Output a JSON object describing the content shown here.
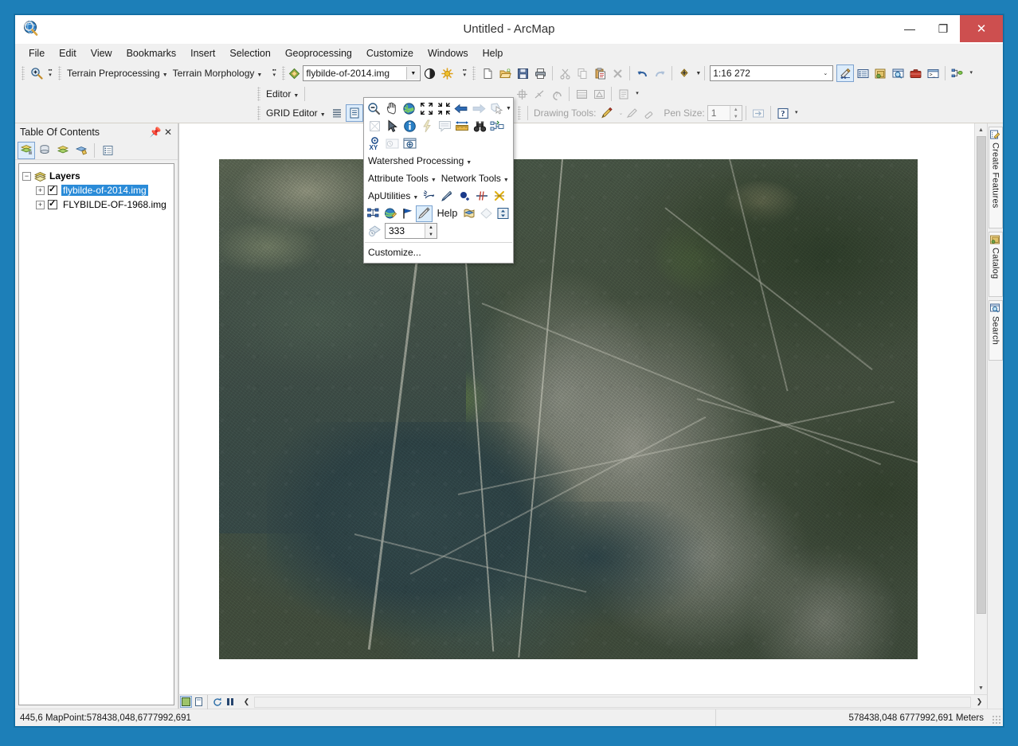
{
  "window": {
    "title": "Untitled - ArcMap",
    "app_icon": "arcmap-globe-icon",
    "minimize_label": "—",
    "maximize_label": "❐",
    "close_label": "✕"
  },
  "menubar": {
    "items": [
      {
        "label": "File"
      },
      {
        "label": "Edit"
      },
      {
        "label": "View"
      },
      {
        "label": "Bookmarks"
      },
      {
        "label": "Insert"
      },
      {
        "label": "Selection"
      },
      {
        "label": "Geoprocessing"
      },
      {
        "label": "Customize"
      },
      {
        "label": "Windows"
      },
      {
        "label": "Help"
      }
    ]
  },
  "toolbars": {
    "terrain": {
      "preprocessing_label": "Terrain Preprocessing",
      "morphology_label": "Terrain Morphology"
    },
    "image_analysis": {
      "layer_value": "flybilde-of-2014.img",
      "contrast_icon": "contrast-icon",
      "brightness_icon": "brightness-icon"
    },
    "standard": {
      "new_icon": "new-document-icon",
      "open_icon": "open-folder-icon",
      "save_icon": "save-icon",
      "print_icon": "print-icon",
      "cut_icon": "cut-icon",
      "copy_icon": "copy-icon",
      "paste_icon": "paste-icon",
      "delete_icon": "delete-x-icon",
      "undo_icon": "undo-icon",
      "redo_icon": "redo-icon",
      "add_data_icon": "add-data-icon",
      "scale_value": "1:16 272",
      "editor_toolbar_icon": "editor-toolbar-icon",
      "toc_icon": "table-of-contents-icon",
      "catalog_icon": "catalog-window-icon",
      "search_icon": "search-window-icon",
      "arctoolbox_icon": "arctoolbox-icon",
      "python_icon": "python-window-icon",
      "modelbuilder_icon": "model-builder-icon"
    },
    "editor": {
      "label": "Editor"
    },
    "grid_editor": {
      "label": "GRID Editor",
      "list_icon": "grid-list-icon",
      "attributes_icon": "grid-attributes-icon"
    },
    "topology": {
      "move_icon": "move-node-icon",
      "line_icon": "sketch-line-icon",
      "undo_icon": "topology-undo-icon",
      "table_icon": "table-icon",
      "errors_icon": "error-inspector-icon",
      "props_icon": "properties-icon"
    },
    "drawing": {
      "label": "Drawing Tools:",
      "pencil_icon": "pencil-icon",
      "highlighter_icon": "highlighter-icon",
      "eraser_icon": "eraser-icon",
      "pen_size_label": "Pen Size:",
      "pen_size_value": "1",
      "apply_icon": "apply-arrow-icon",
      "help_icon": "help-question-icon"
    }
  },
  "overflow_panel": {
    "row1": [
      {
        "icon": "zoom-out-icon",
        "name": "zoom-out"
      },
      {
        "icon": "pan-hand-icon",
        "name": "pan"
      },
      {
        "icon": "full-extent-globe-icon",
        "name": "full-extent"
      },
      {
        "icon": "fixed-zoom-in-icon",
        "name": "fixed-zoom-in"
      },
      {
        "icon": "fixed-zoom-out-icon",
        "name": "fixed-zoom-out"
      },
      {
        "icon": "back-extent-arrow-icon",
        "name": "previous-extent"
      },
      {
        "icon": "forward-extent-arrow-icon",
        "name": "next-extent"
      },
      {
        "icon": "select-features-icon",
        "name": "select-features"
      }
    ],
    "row2": [
      {
        "icon": "select-graphics-icon",
        "name": "select-elements"
      },
      {
        "icon": "pointer-arrow-icon",
        "name": "select-elements-pointer"
      },
      {
        "icon": "identify-info-icon",
        "name": "identify"
      },
      {
        "icon": "hyperlink-lightning-icon",
        "name": "hyperlink"
      },
      {
        "icon": "html-popup-icon",
        "name": "html-popup"
      },
      {
        "icon": "measure-ruler-icon",
        "name": "measure"
      },
      {
        "icon": "find-binoculars-icon",
        "name": "find"
      },
      {
        "icon": "find-route-icon",
        "name": "find-route"
      }
    ],
    "row3": [
      {
        "icon": "go-to-xy-icon",
        "name": "go-to-xy"
      },
      {
        "icon": "time-slider-icon",
        "name": "time-slider"
      },
      {
        "icon": "create-viewer-window-icon",
        "name": "create-viewer-window"
      }
    ],
    "watershed_label": "Watershed Processing",
    "attribute_tools_label": "Attribute Tools",
    "network_tools_label": "Network Tools",
    "aputilities_label": "ApUtilities",
    "aputil_icons": [
      {
        "icon": "trace-network-icon",
        "name": "trace-network"
      },
      {
        "icon": "edit-line-icon",
        "name": "edit-line"
      },
      {
        "icon": "add-point-icon",
        "name": "add-point"
      },
      {
        "icon": "split-line-icon",
        "name": "split-line"
      },
      {
        "icon": "delete-feature-icon",
        "name": "delete-feature"
      }
    ],
    "row5": [
      {
        "icon": "schematic-network-icon",
        "name": "schematic-network"
      },
      {
        "icon": "globe-edit-icon",
        "name": "globe-edit"
      },
      {
        "icon": "flag-icon",
        "name": "set-flag"
      },
      {
        "icon": "pencil-edit-icon",
        "name": "pencil-edit",
        "active": true
      }
    ],
    "help_label": "Help",
    "row5b": [
      {
        "icon": "layer-package-icon",
        "name": "layer-package"
      },
      {
        "icon": "diamond-icon",
        "name": "diamond-tool"
      },
      {
        "icon": "elevation-profile-icon",
        "name": "elevation-profile"
      }
    ],
    "spin_icon": "history-clock-icon",
    "spin_value": "333",
    "customize_label": "Customize..."
  },
  "toc": {
    "title": "Table Of Contents",
    "pin_icon": "pin-icon",
    "close_icon": "close-icon",
    "toolbar": [
      {
        "icon": "list-by-drawing-order-icon",
        "name": "list-by-drawing-order",
        "active": true
      },
      {
        "icon": "list-by-source-icon",
        "name": "list-by-source"
      },
      {
        "icon": "list-by-visibility-icon",
        "name": "list-by-visibility"
      },
      {
        "icon": "list-by-selection-icon",
        "name": "list-by-selection"
      },
      {
        "icon": "options-icon",
        "name": "toc-options"
      }
    ],
    "root": {
      "label": "Layers",
      "expander": "−",
      "icon": "layers-stack-icon"
    },
    "layers": [
      {
        "label": "flybilde-of-2014.img",
        "checked": true,
        "selected": true,
        "expander": "+"
      },
      {
        "label": "FLYBILDE-OF-1968.img",
        "checked": true,
        "selected": false,
        "expander": "+"
      }
    ]
  },
  "map_bottom": {
    "data_view_icon": "data-view-icon",
    "layout_view_icon": "layout-view-icon",
    "refresh_icon": "refresh-icon",
    "pause_icon": "pause-drawing-icon",
    "collapse_icon": "collapse-arrow-icon"
  },
  "sidetabs": [
    {
      "label": "Create Features",
      "icon": "create-features-icon"
    },
    {
      "label": "Catalog",
      "icon": "catalog-icon"
    },
    {
      "label": "Search",
      "icon": "search-icon"
    }
  ],
  "statusbar": {
    "left": "445,6 MapPoint:578438,048,6777992,691",
    "right": "578438,048  6777992,691 Meters"
  },
  "colors": {
    "window_chrome": "#f0f0f0",
    "desktop": "#1d7fb8",
    "selection_blue": "#2a8bd8",
    "close_red": "#cd4f4f",
    "accent_border": "#0a6ba3"
  }
}
